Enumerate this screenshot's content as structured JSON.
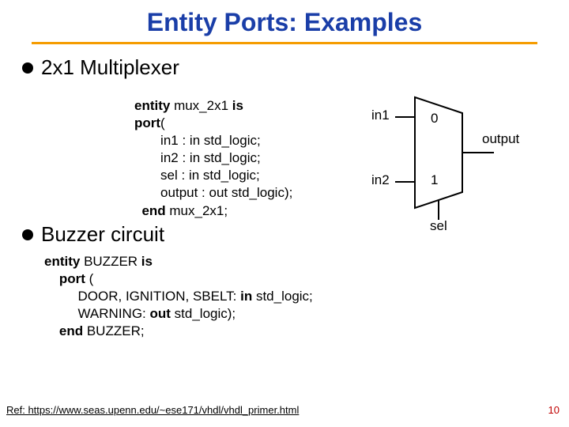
{
  "title": "Entity Ports: Examples",
  "bullets": {
    "b1": "2x1 Multiplexer",
    "b2": "Buzzer circuit"
  },
  "code1": {
    "l1a": "entity",
    "l1b": " mux_2x1 ",
    "l1c": "is",
    "l2a": "port",
    "l2b": "(",
    "l3": "       in1 : in std_logic;",
    "l4": "       in2 : in std_logic;",
    "l5": "       sel : in std_logic;",
    "l6": "       output : out std_logic);",
    "l7a": "  end",
    "l7b": " mux_2x1;"
  },
  "mux": {
    "in1": "in1",
    "in2": "in2",
    "zero": "0",
    "one": "1",
    "sel": "sel",
    "output": "output"
  },
  "code2": {
    "l1a": "entity",
    "l1b": " BUZZER ",
    "l1c": "is",
    "l2a": "    port",
    "l2b": " (",
    "l3a": "         DOOR, IGNITION, SBELT: ",
    "l3b": "in",
    "l3c": " std_logic;",
    "l4a": "         WARNING: ",
    "l4b": "out",
    "l4c": " std_logic);",
    "l5a": "    end",
    "l5b": " BUZZER;"
  },
  "ref": "Ref: https://www.seas.upenn.edu/~ese171/vhdl/vhdl_primer.html",
  "pagenum": "10"
}
